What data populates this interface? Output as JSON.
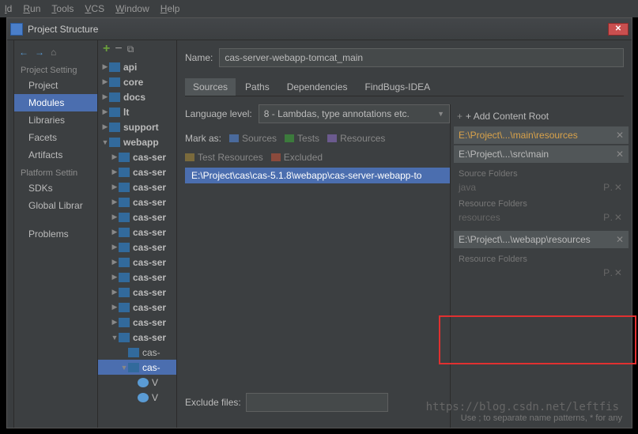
{
  "menubar": [
    "ld",
    "Run",
    "Tools",
    "VCS",
    "Window",
    "Help"
  ],
  "dialog_title": "Project Structure",
  "nav": {
    "back": "←",
    "fwd": "→",
    "home": "⌂",
    "section1": "Project Setting",
    "items1": [
      "Project",
      "Modules",
      "Libraries",
      "Facets",
      "Artifacts"
    ],
    "section2": "Platform Settin",
    "items2": [
      "SDKs",
      "Global Librar"
    ],
    "problems": "Problems"
  },
  "tree": [
    {
      "depth": 0,
      "arrow": "closed",
      "icon": "mod",
      "label": "api",
      "bold": true
    },
    {
      "depth": 0,
      "arrow": "closed",
      "icon": "mod",
      "label": "core",
      "bold": true
    },
    {
      "depth": 0,
      "arrow": "closed",
      "icon": "mod",
      "label": "docs",
      "bold": true
    },
    {
      "depth": 0,
      "arrow": "closed",
      "icon": "mod",
      "label": "lt",
      "bold": true
    },
    {
      "depth": 0,
      "arrow": "closed",
      "icon": "mod",
      "label": "support",
      "bold": true
    },
    {
      "depth": 0,
      "arrow": "open",
      "icon": "mod",
      "label": "webapp",
      "bold": true
    },
    {
      "depth": 1,
      "arrow": "closed",
      "icon": "mod",
      "label": "cas-ser",
      "bold": true
    },
    {
      "depth": 1,
      "arrow": "closed",
      "icon": "mod",
      "label": "cas-ser",
      "bold": true
    },
    {
      "depth": 1,
      "arrow": "closed",
      "icon": "mod",
      "label": "cas-ser",
      "bold": true
    },
    {
      "depth": 1,
      "arrow": "closed",
      "icon": "mod",
      "label": "cas-ser",
      "bold": true
    },
    {
      "depth": 1,
      "arrow": "closed",
      "icon": "mod",
      "label": "cas-ser",
      "bold": true
    },
    {
      "depth": 1,
      "arrow": "closed",
      "icon": "mod",
      "label": "cas-ser",
      "bold": true
    },
    {
      "depth": 1,
      "arrow": "closed",
      "icon": "mod",
      "label": "cas-ser",
      "bold": true
    },
    {
      "depth": 1,
      "arrow": "closed",
      "icon": "mod",
      "label": "cas-ser",
      "bold": true
    },
    {
      "depth": 1,
      "arrow": "closed",
      "icon": "mod",
      "label": "cas-ser",
      "bold": true
    },
    {
      "depth": 1,
      "arrow": "closed",
      "icon": "mod",
      "label": "cas-ser",
      "bold": true
    },
    {
      "depth": 1,
      "arrow": "closed",
      "icon": "mod",
      "label": "cas-ser",
      "bold": true
    },
    {
      "depth": 1,
      "arrow": "closed",
      "icon": "mod",
      "label": "cas-ser",
      "bold": true
    },
    {
      "depth": 1,
      "arrow": "open",
      "icon": "mod",
      "label": "cas-ser",
      "bold": true
    },
    {
      "depth": 2,
      "arrow": "none",
      "icon": "mod",
      "label": "cas-",
      "bold": false
    },
    {
      "depth": 2,
      "arrow": "open",
      "icon": "mod",
      "label": "cas-",
      "bold": false,
      "sel": true
    },
    {
      "depth": 3,
      "arrow": "none",
      "icon": "web",
      "label": "V",
      "bold": false
    },
    {
      "depth": 3,
      "arrow": "none",
      "icon": "web",
      "label": "V",
      "bold": false
    }
  ],
  "module": {
    "name_label": "Name:",
    "name_value": "cas-server-webapp-tomcat_main",
    "tabs": [
      "Sources",
      "Paths",
      "Dependencies",
      "FindBugs-IDEA"
    ],
    "lang_label": "Language level:",
    "lang_value": "8 - Lambdas, type annotations etc.",
    "mark_label": "Mark as:",
    "marks": [
      "Sources",
      "Tests",
      "Resources",
      "Test Resources",
      "Excluded"
    ],
    "path": "E:\\Project\\cas\\cas-5.1.8\\webapp\\cas-server-webapp-to"
  },
  "roots": {
    "add": "+ Add Content Root",
    "items": [
      {
        "label": "E:\\Project\\...\\main\\resources",
        "sel": true
      },
      {
        "label": "E:\\Project\\...\\src\\main",
        "sel": false
      },
      {
        "label": "E:\\Project\\...\\webapp\\resources",
        "sel": false,
        "boxstart": true
      }
    ],
    "sub": [
      {
        "hdr": "Source Folders",
        "line": "java"
      },
      {
        "hdr": "Resource Folders",
        "line": "resources"
      },
      {
        "hdr": "Resource Folders",
        "line": ""
      }
    ]
  },
  "exclude": {
    "label": "Exclude files:",
    "hint": "Use ; to separate name patterns, * for any"
  },
  "watermark": "https://blog.csdn.net/leftfis"
}
